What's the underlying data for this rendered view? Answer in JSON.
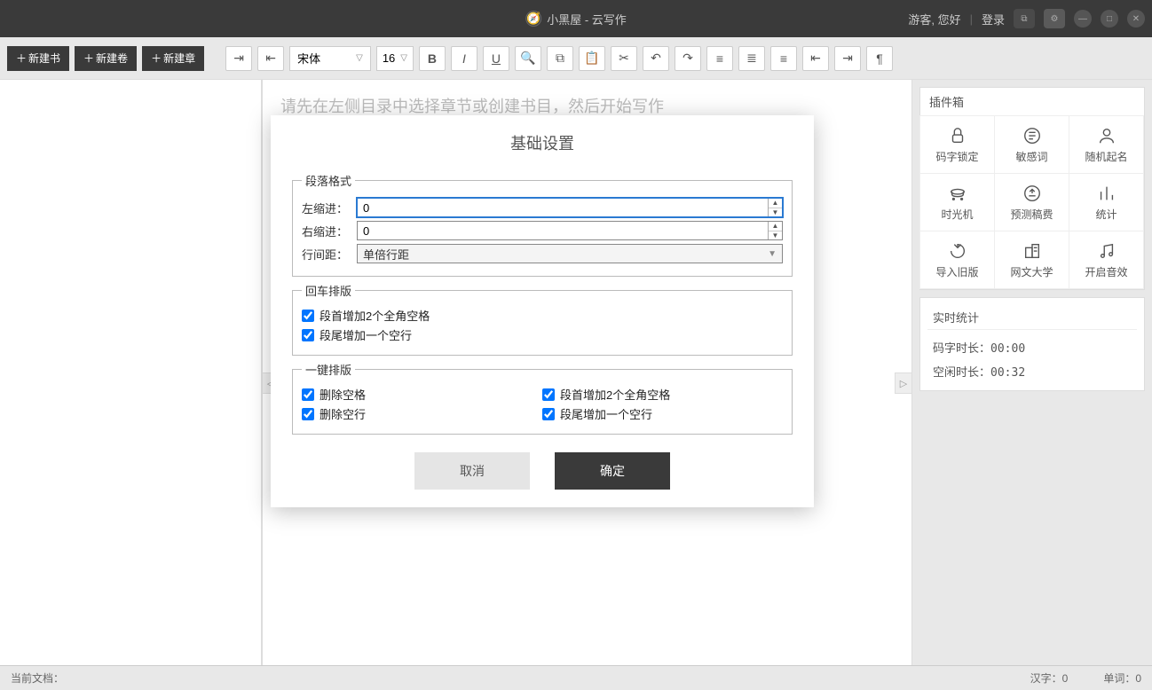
{
  "titlebar": {
    "app": "小黑屋 - 云写作",
    "guest": "游客, 您好",
    "login": "登录"
  },
  "toolbar": {
    "newBook": "新建书",
    "newVolume": "新建卷",
    "newChapter": "新建章",
    "font": "宋体",
    "fontSize": "16"
  },
  "editor": {
    "placeholder": "请先在左侧目录中选择章节或创建书目，然后开始写作"
  },
  "pluginBox": {
    "title": "插件箱",
    "items": [
      {
        "label": "码字锁定",
        "name": "plugin-lock"
      },
      {
        "label": "敏感词",
        "name": "plugin-sensitive"
      },
      {
        "label": "随机起名",
        "name": "plugin-naming"
      },
      {
        "label": "时光机",
        "name": "plugin-timemachine"
      },
      {
        "label": "预测稿费",
        "name": "plugin-fee"
      },
      {
        "label": "统计",
        "name": "plugin-stats"
      },
      {
        "label": "导入旧版",
        "name": "plugin-import"
      },
      {
        "label": "网文大学",
        "name": "plugin-university"
      },
      {
        "label": "开启音效",
        "name": "plugin-sound"
      }
    ]
  },
  "liveStats": {
    "title": "实时统计",
    "typingLabel": "码字时长：",
    "typingVal": "00:00",
    "idleLabel": "空闲时长：",
    "idleVal": "00:32"
  },
  "statusbar": {
    "curDoc": "当前文档：",
    "hanzi": "汉字：0",
    "words": "单词：0"
  },
  "modal": {
    "title": "基础设置",
    "paraLegend": "段落格式",
    "leftIndent": "左缩进：",
    "leftIndentVal": "0",
    "rightIndent": "右缩进：",
    "rightIndentVal": "0",
    "lineSpacing": "行间距：",
    "lineSpacingVal": "单倍行距",
    "enterLegend": "回车排版",
    "enterOpt1": "段首增加2个全角空格",
    "enterOpt2": "段尾增加一个空行",
    "formatLegend": "一键排版",
    "fmt1": "删除空格",
    "fmt2": "删除空行",
    "fmt3": "段首增加2个全角空格",
    "fmt4": "段尾增加一个空行",
    "cancel": "取消",
    "ok": "确定"
  }
}
